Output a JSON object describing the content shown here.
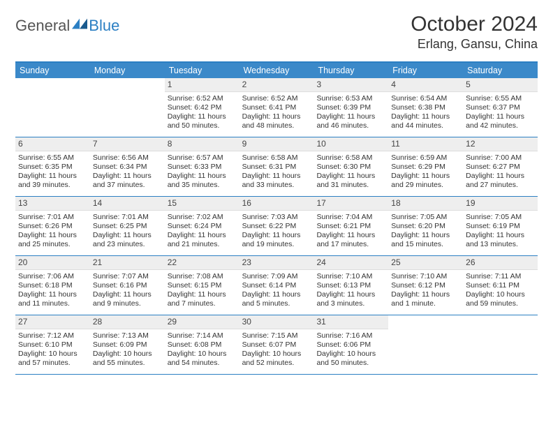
{
  "logo": {
    "word1": "General",
    "word2": "Blue"
  },
  "title": "October 2024",
  "location": "Erlang, Gansu, China",
  "dow": [
    "Sunday",
    "Monday",
    "Tuesday",
    "Wednesday",
    "Thursday",
    "Friday",
    "Saturday"
  ],
  "weeks": [
    [
      null,
      null,
      {
        "n": "1",
        "sr": "6:52 AM",
        "ss": "6:42 PM",
        "dl": "11 hours and 50 minutes."
      },
      {
        "n": "2",
        "sr": "6:52 AM",
        "ss": "6:41 PM",
        "dl": "11 hours and 48 minutes."
      },
      {
        "n": "3",
        "sr": "6:53 AM",
        "ss": "6:39 PM",
        "dl": "11 hours and 46 minutes."
      },
      {
        "n": "4",
        "sr": "6:54 AM",
        "ss": "6:38 PM",
        "dl": "11 hours and 44 minutes."
      },
      {
        "n": "5",
        "sr": "6:55 AM",
        "ss": "6:37 PM",
        "dl": "11 hours and 42 minutes."
      }
    ],
    [
      {
        "n": "6",
        "sr": "6:55 AM",
        "ss": "6:35 PM",
        "dl": "11 hours and 39 minutes."
      },
      {
        "n": "7",
        "sr": "6:56 AM",
        "ss": "6:34 PM",
        "dl": "11 hours and 37 minutes."
      },
      {
        "n": "8",
        "sr": "6:57 AM",
        "ss": "6:33 PM",
        "dl": "11 hours and 35 minutes."
      },
      {
        "n": "9",
        "sr": "6:58 AM",
        "ss": "6:31 PM",
        "dl": "11 hours and 33 minutes."
      },
      {
        "n": "10",
        "sr": "6:58 AM",
        "ss": "6:30 PM",
        "dl": "11 hours and 31 minutes."
      },
      {
        "n": "11",
        "sr": "6:59 AM",
        "ss": "6:29 PM",
        "dl": "11 hours and 29 minutes."
      },
      {
        "n": "12",
        "sr": "7:00 AM",
        "ss": "6:27 PM",
        "dl": "11 hours and 27 minutes."
      }
    ],
    [
      {
        "n": "13",
        "sr": "7:01 AM",
        "ss": "6:26 PM",
        "dl": "11 hours and 25 minutes."
      },
      {
        "n": "14",
        "sr": "7:01 AM",
        "ss": "6:25 PM",
        "dl": "11 hours and 23 minutes."
      },
      {
        "n": "15",
        "sr": "7:02 AM",
        "ss": "6:24 PM",
        "dl": "11 hours and 21 minutes."
      },
      {
        "n": "16",
        "sr": "7:03 AM",
        "ss": "6:22 PM",
        "dl": "11 hours and 19 minutes."
      },
      {
        "n": "17",
        "sr": "7:04 AM",
        "ss": "6:21 PM",
        "dl": "11 hours and 17 minutes."
      },
      {
        "n": "18",
        "sr": "7:05 AM",
        "ss": "6:20 PM",
        "dl": "11 hours and 15 minutes."
      },
      {
        "n": "19",
        "sr": "7:05 AM",
        "ss": "6:19 PM",
        "dl": "11 hours and 13 minutes."
      }
    ],
    [
      {
        "n": "20",
        "sr": "7:06 AM",
        "ss": "6:18 PM",
        "dl": "11 hours and 11 minutes."
      },
      {
        "n": "21",
        "sr": "7:07 AM",
        "ss": "6:16 PM",
        "dl": "11 hours and 9 minutes."
      },
      {
        "n": "22",
        "sr": "7:08 AM",
        "ss": "6:15 PM",
        "dl": "11 hours and 7 minutes."
      },
      {
        "n": "23",
        "sr": "7:09 AM",
        "ss": "6:14 PM",
        "dl": "11 hours and 5 minutes."
      },
      {
        "n": "24",
        "sr": "7:10 AM",
        "ss": "6:13 PM",
        "dl": "11 hours and 3 minutes."
      },
      {
        "n": "25",
        "sr": "7:10 AM",
        "ss": "6:12 PM",
        "dl": "11 hours and 1 minute."
      },
      {
        "n": "26",
        "sr": "7:11 AM",
        "ss": "6:11 PM",
        "dl": "10 hours and 59 minutes."
      }
    ],
    [
      {
        "n": "27",
        "sr": "7:12 AM",
        "ss": "6:10 PM",
        "dl": "10 hours and 57 minutes."
      },
      {
        "n": "28",
        "sr": "7:13 AM",
        "ss": "6:09 PM",
        "dl": "10 hours and 55 minutes."
      },
      {
        "n": "29",
        "sr": "7:14 AM",
        "ss": "6:08 PM",
        "dl": "10 hours and 54 minutes."
      },
      {
        "n": "30",
        "sr": "7:15 AM",
        "ss": "6:07 PM",
        "dl": "10 hours and 52 minutes."
      },
      {
        "n": "31",
        "sr": "7:16 AM",
        "ss": "6:06 PM",
        "dl": "10 hours and 50 minutes."
      },
      null,
      null
    ]
  ],
  "labels": {
    "sunrise": "Sunrise: ",
    "sunset": "Sunset: ",
    "daylight": "Daylight: "
  }
}
